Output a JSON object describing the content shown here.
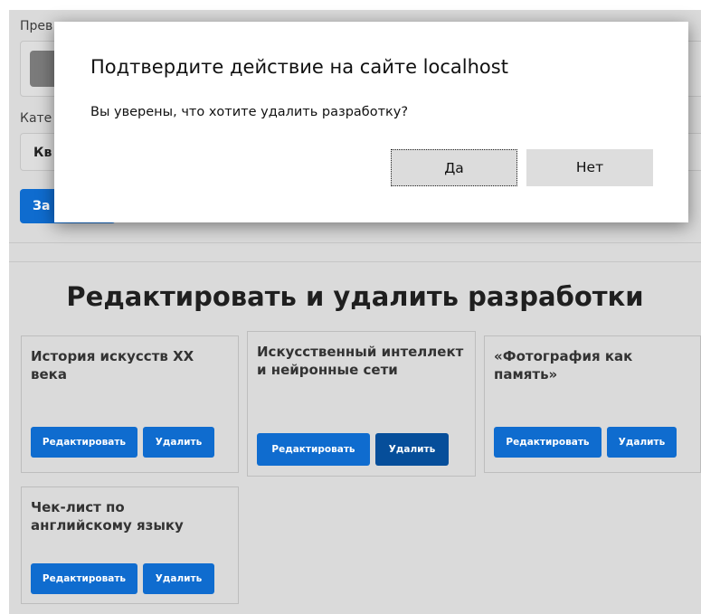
{
  "form": {
    "preview_label": "Прев",
    "category_label": "Кате",
    "category_value": "Кв",
    "submit_label": "За"
  },
  "section": {
    "title": "Редактировать и удалить разработки"
  },
  "cards": [
    {
      "title": "История искусств XX века",
      "edit_label": "Редактировать",
      "delete_label": "Удалить"
    },
    {
      "title": "Искусственный интеллект и нейронные сети",
      "edit_label": "Редактировать",
      "delete_label": "Удалить"
    },
    {
      "title": "«Фотография как память»",
      "edit_label": "Редактировать",
      "delete_label": "Удалить"
    },
    {
      "title": "Чек-лист по английскому языку",
      "edit_label": "Редактировать",
      "delete_label": "Удалить"
    }
  ],
  "dialog": {
    "title": "Подтвердите действие на сайте localhost",
    "message": "Вы уверены, что хотите удалить разработку?",
    "yes_label": "Да",
    "no_label": "Нет"
  },
  "colors": {
    "primary_button": "#0f6ccf",
    "primary_button_hover": "#064e9a",
    "page_background_dimmed": "#dadada",
    "dialog_background": "#ffffff"
  }
}
